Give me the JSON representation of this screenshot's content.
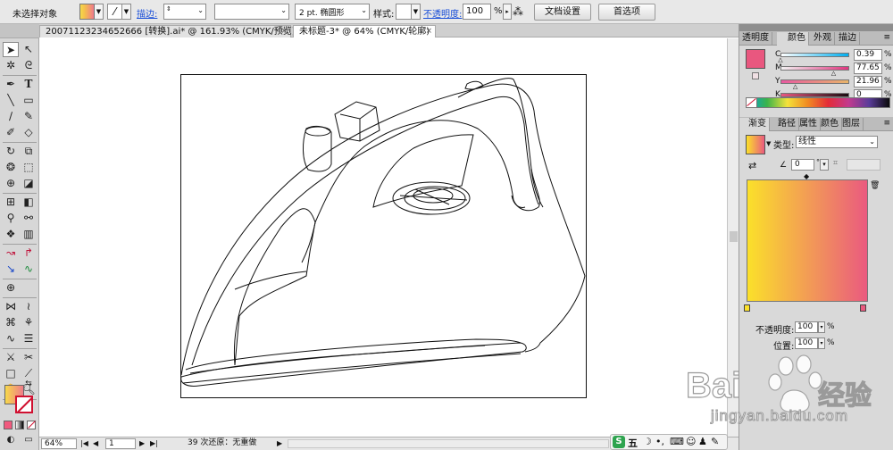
{
  "control_bar": {
    "selection_status": "未选择对象",
    "stroke_label": "描边:",
    "stroke_weight_value": "",
    "brush_value": "2 pt. 椭圆形",
    "style_label": "样式:",
    "opacity_label": "不透明度:",
    "opacity_value": "100",
    "opacity_unit": "%",
    "document_setup_button": "文档设置",
    "preferences_button": "首选项"
  },
  "tabs": [
    {
      "label": "20071123234652666 [转换].ai* @ 161.93% (CMYK/预览)",
      "close": "×"
    },
    {
      "label": "未标题-3* @ 64% (CMYK/轮廓)",
      "close": "×"
    }
  ],
  "status_bar": {
    "zoom": "64%",
    "page": "1",
    "message": "39 次还原：无重做"
  },
  "color_panel": {
    "tabs": [
      "透明度",
      "颜色",
      "外观",
      "描边"
    ],
    "active_tab": "颜色",
    "fill_color": "#e9577f",
    "channels": [
      {
        "label": "C",
        "value": "0.39",
        "fraction": 0.004,
        "gradient": "linear-gradient(90deg,#ffffff,#00aeef)"
      },
      {
        "label": "M",
        "value": "77.65",
        "fraction": 0.7765,
        "gradient": "linear-gradient(90deg,#f2f2f2,#e0357f)"
      },
      {
        "label": "Y",
        "value": "21.96",
        "fraction": 0.2196,
        "gradient": "linear-gradient(90deg,#e85aa0,#e8b56a)"
      },
      {
        "label": "K",
        "value": "0",
        "fraction": 0,
        "gradient": "linear-gradient(90deg,#e9577f,#1a0b10)"
      }
    ],
    "unit": "%"
  },
  "gradient_panel": {
    "tabs": [
      "渐变",
      "路径",
      "属性",
      "颜色",
      "图层"
    ],
    "active_tab": "渐变",
    "type_label": "类型:",
    "type_value": "线性",
    "angle_value": "0",
    "angle_unit": "°",
    "start_color": "#fbe02a",
    "end_color": "#ea5a7f",
    "opacity_label": "不透明度:",
    "opacity_value": "100",
    "position_label": "位置:",
    "position_value": "100",
    "unit": "%"
  },
  "tool_colors": {
    "fill_gradient": "linear-gradient(90deg,#f7d94a,#ef7b8a)"
  },
  "watermark": {
    "brand": "Bai",
    "brand2": "经验",
    "url": "jingyan.baidu.com"
  },
  "ime_bar": {
    "label": "五"
  }
}
